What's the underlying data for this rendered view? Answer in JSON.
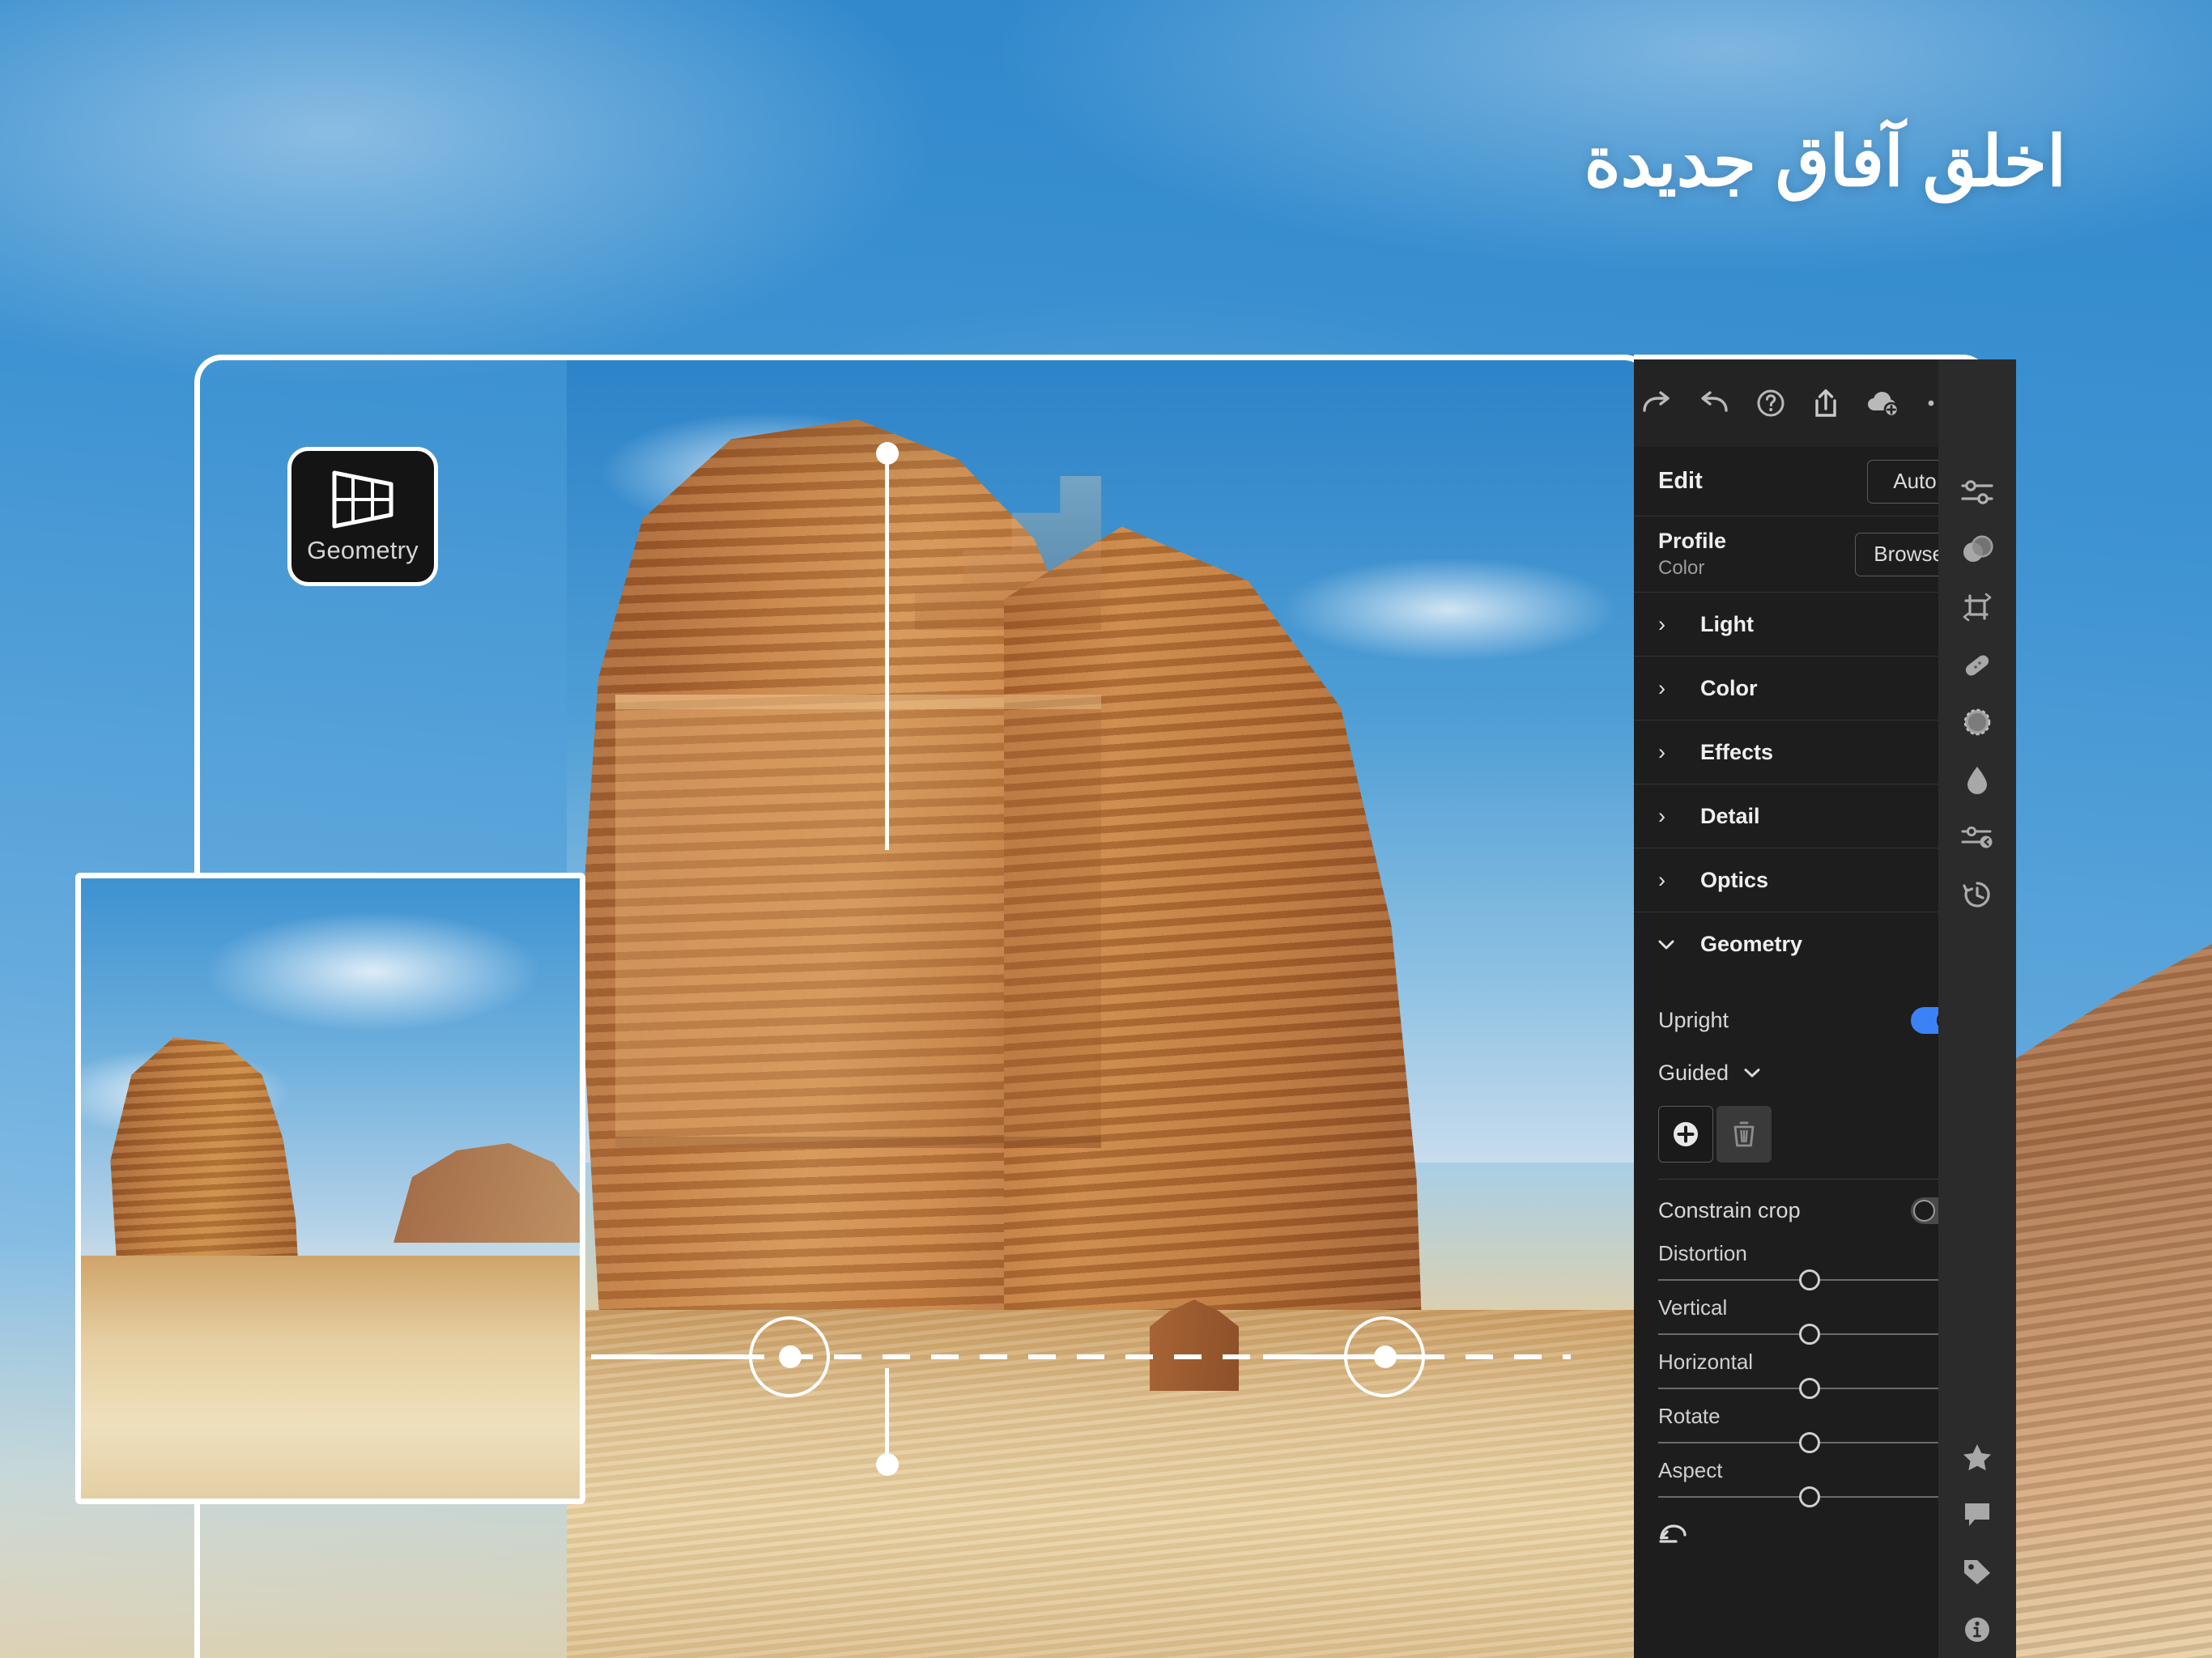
{
  "marketing": {
    "headline": "اخلق آفاق جديدة"
  },
  "tool_badge": {
    "label": "Geometry",
    "icon": "perspective-grid-icon"
  },
  "panel": {
    "toolbar": [
      {
        "name": "redo-icon",
        "label": "Redo"
      },
      {
        "name": "undo-icon",
        "label": "Undo"
      },
      {
        "name": "help-icon",
        "label": "Help"
      },
      {
        "name": "share-icon",
        "label": "Share"
      },
      {
        "name": "cloud-add-icon",
        "label": "Add to cloud"
      },
      {
        "name": "more-icon",
        "label": "More options"
      }
    ],
    "edit": {
      "title": "Edit",
      "auto_label": "Auto"
    },
    "profile": {
      "label": "Profile",
      "value": "Color",
      "browse_label": "Browse"
    },
    "sections": [
      {
        "label": "Light",
        "expanded": false,
        "chevron": "›"
      },
      {
        "label": "Color",
        "expanded": false,
        "chevron": "›"
      },
      {
        "label": "Effects",
        "expanded": false,
        "chevron": "›"
      },
      {
        "label": "Detail",
        "expanded": false,
        "chevron": "›"
      },
      {
        "label": "Optics",
        "expanded": false,
        "chevron": "›"
      },
      {
        "label": "Geometry",
        "expanded": true,
        "chevron": "⌄"
      }
    ],
    "geometry": {
      "upright": {
        "label": "Upright",
        "state": "on"
      },
      "mode": {
        "value": "Guided"
      },
      "add_button_label": "Add guide",
      "delete_button_label": "Delete guide",
      "constrain_crop": {
        "label": "Constrain crop",
        "state": "off"
      },
      "sliders": [
        {
          "label": "Distortion",
          "value": "0"
        },
        {
          "label": "Vertical",
          "value": "0"
        },
        {
          "label": "Horizontal",
          "value": "0"
        },
        {
          "label": "Rotate",
          "value": "0"
        },
        {
          "label": "Aspect",
          "value": "0"
        }
      ],
      "reset_label": "Reset"
    }
  },
  "rail": [
    {
      "name": "edit-sliders-icon",
      "label": "Edit"
    },
    {
      "name": "masking-icon",
      "label": "Masking"
    },
    {
      "name": "crop-icon",
      "label": "Crop & Rotate"
    },
    {
      "name": "healing-icon",
      "label": "Healing"
    },
    {
      "name": "remove-icon",
      "label": "Remove"
    },
    {
      "name": "presets-drop-icon",
      "label": "Presets"
    },
    {
      "name": "previous-edits-icon",
      "label": "Previous edits"
    },
    {
      "name": "versions-history-icon",
      "label": "Versions"
    },
    {
      "name": "rating-star-icon",
      "label": "Rating"
    },
    {
      "name": "comments-icon",
      "label": "Comments"
    },
    {
      "name": "keywords-tag-icon",
      "label": "Keywords"
    },
    {
      "name": "info-icon",
      "label": "Info"
    }
  ],
  "colors": {
    "accent_blue": "#3b82f6",
    "panel_bg": "#1d1d1d",
    "toolbar_bg": "#232323",
    "rail_bg": "#2b2b2b"
  }
}
